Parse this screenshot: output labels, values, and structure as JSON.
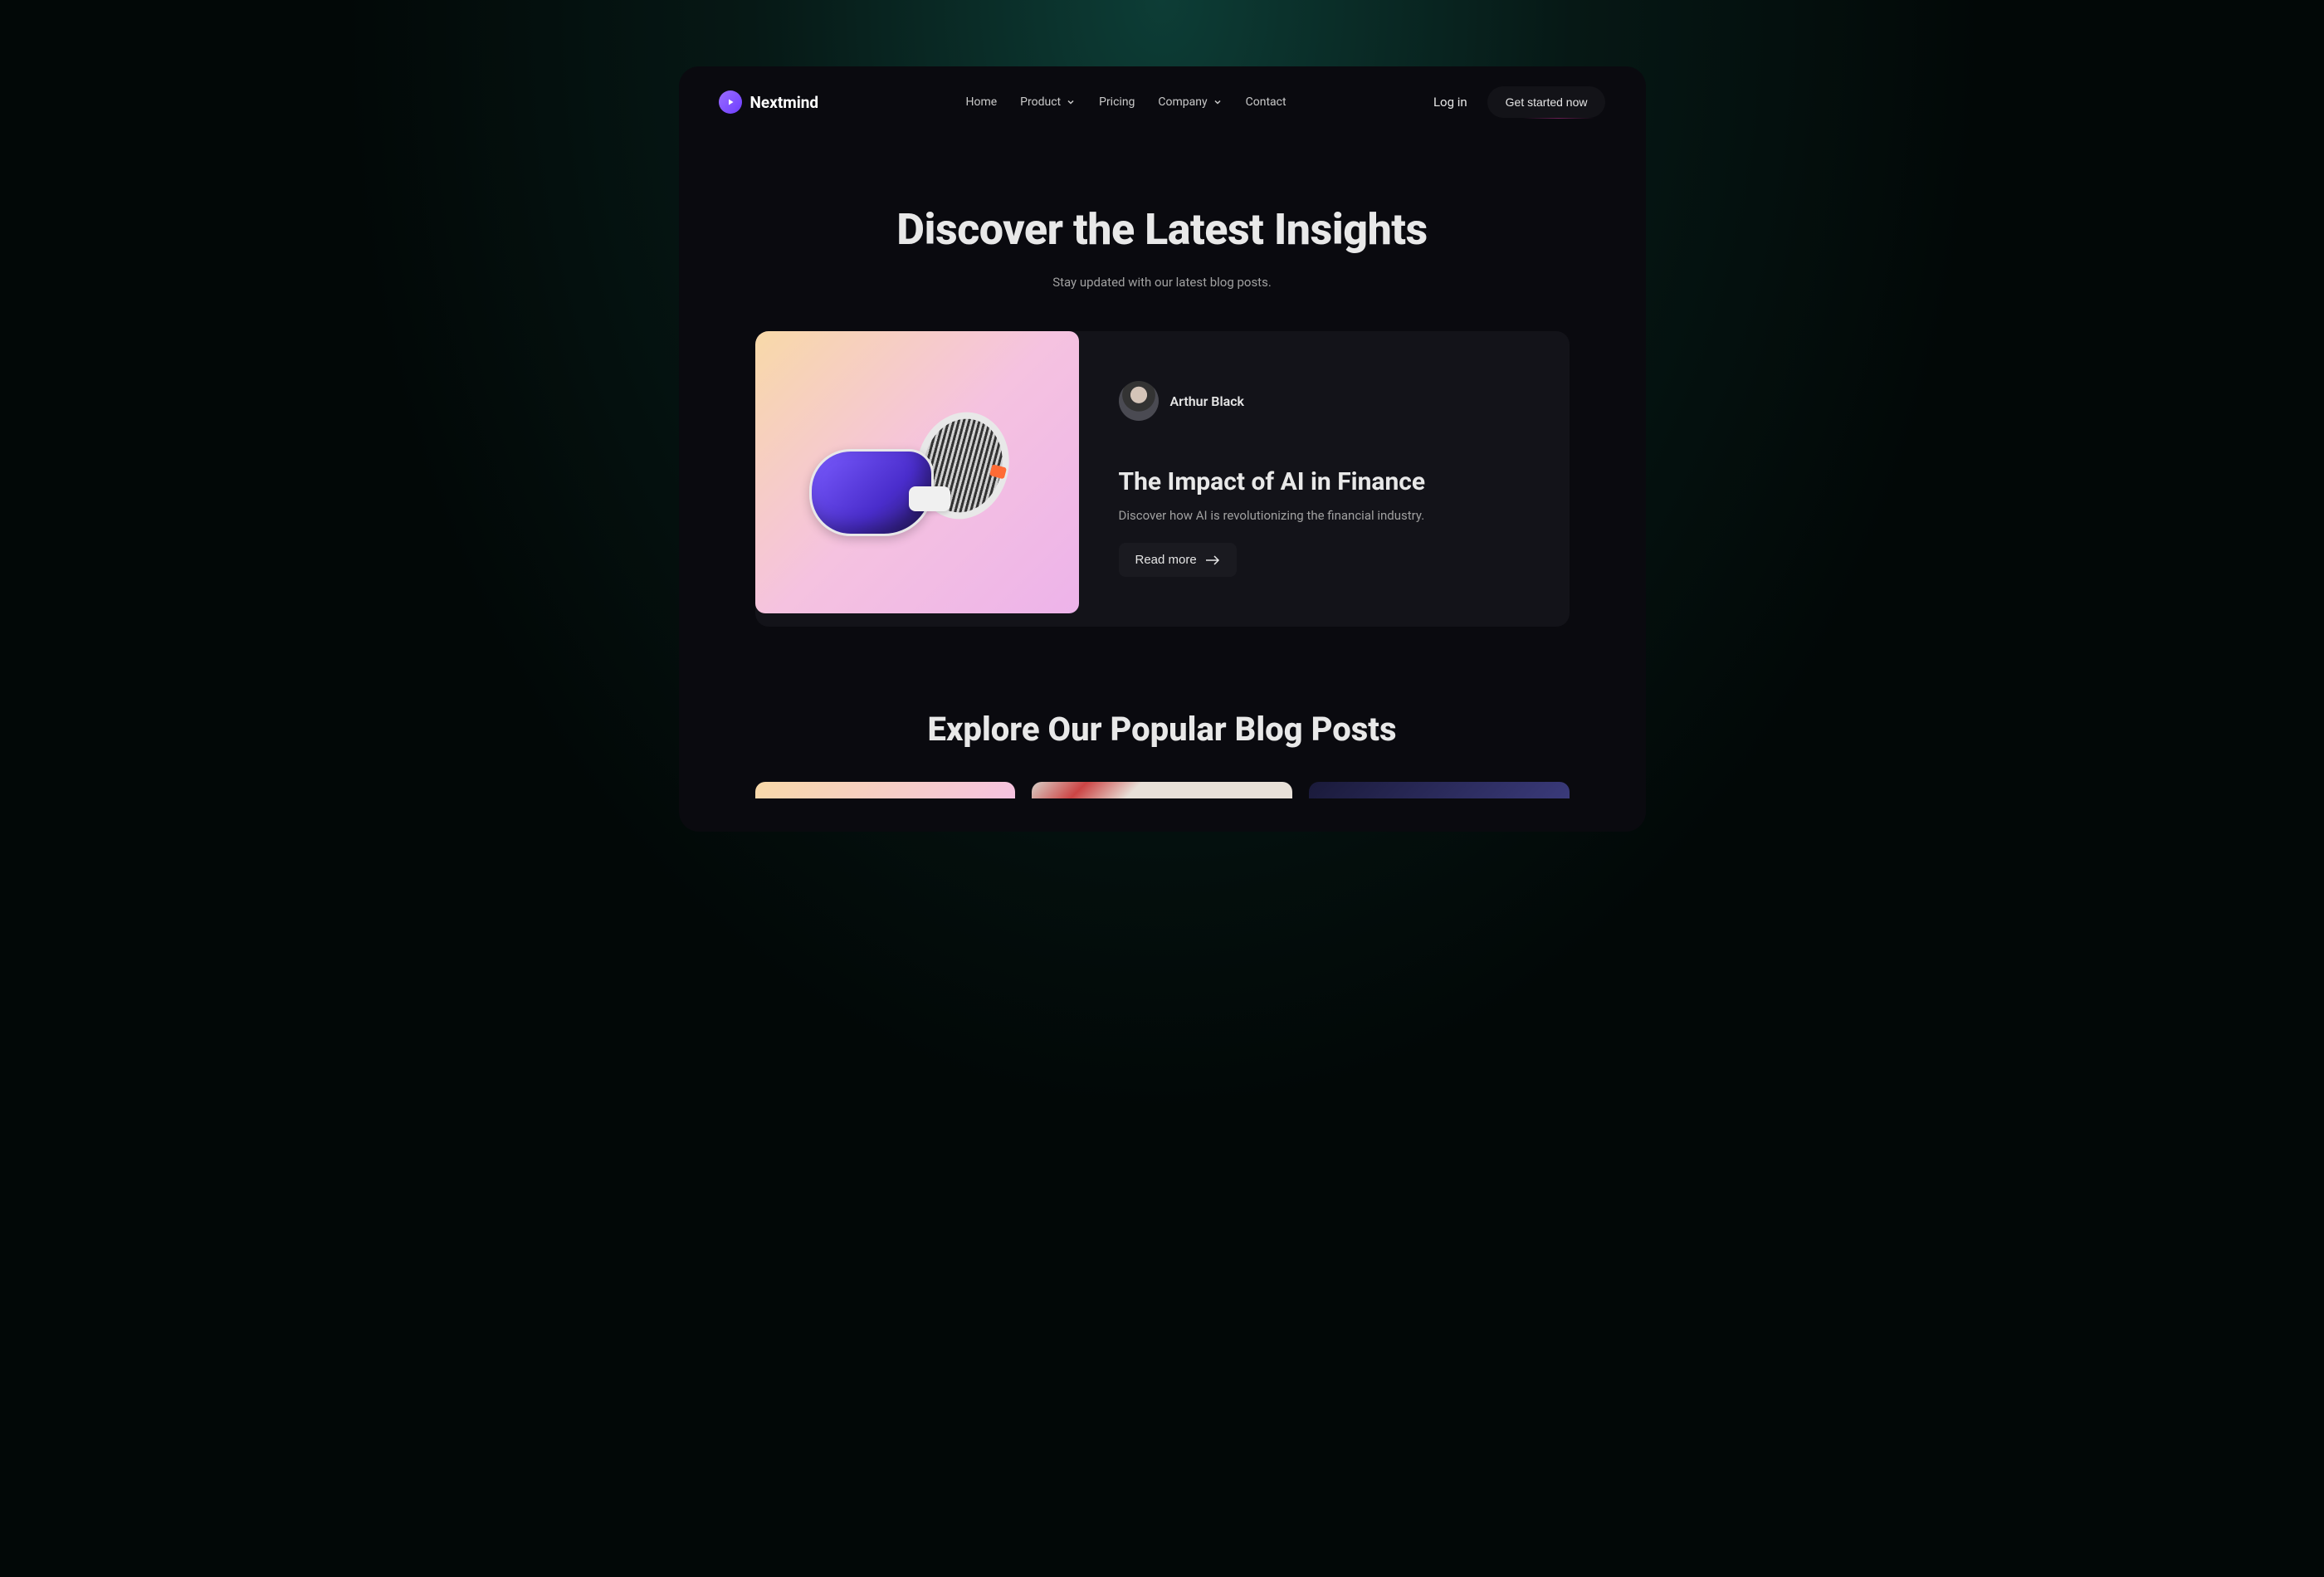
{
  "brand": "Nextmind",
  "nav": {
    "items": [
      {
        "label": "Home",
        "hasDropdown": false
      },
      {
        "label": "Product",
        "hasDropdown": true
      },
      {
        "label": "Pricing",
        "hasDropdown": false
      },
      {
        "label": "Company",
        "hasDropdown": true
      },
      {
        "label": "Contact",
        "hasDropdown": false
      }
    ]
  },
  "header": {
    "login": "Log in",
    "cta": "Get started now"
  },
  "hero": {
    "title": "Discover the Latest Insights",
    "subtitle": "Stay updated with our latest blog posts."
  },
  "featured": {
    "author_name": "Arthur Black",
    "title": "The Impact of AI in Finance",
    "description": "Discover how AI is revolutionizing the financial industry.",
    "read_more": "Read more"
  },
  "blog_section": {
    "title": "Explore Our Popular Blog Posts"
  }
}
